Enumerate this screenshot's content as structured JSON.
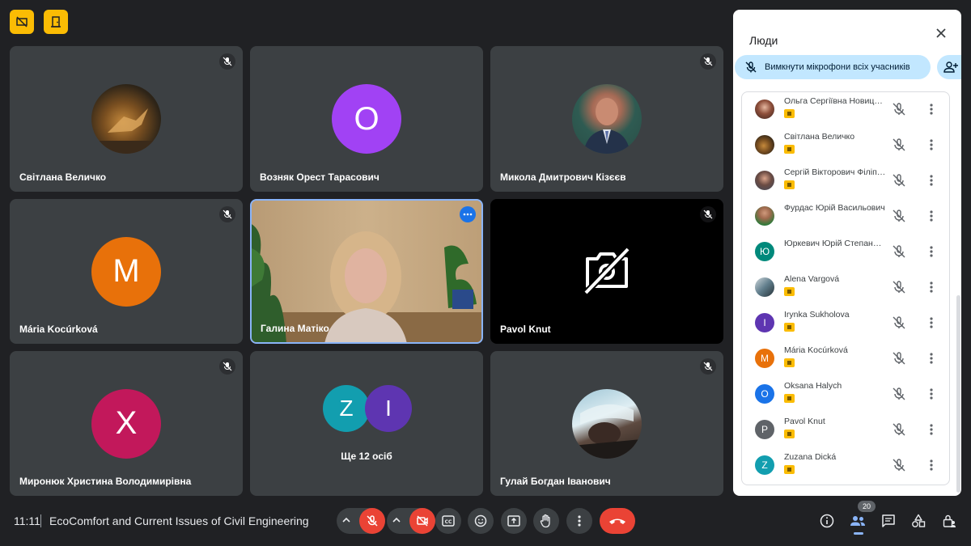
{
  "tiles": [
    {
      "name": "Світлана Величко",
      "avatar_type": "photo-dragon"
    },
    {
      "name": "Возняк Орест Тарасович",
      "initial": "O",
      "color": "#a142f4"
    },
    {
      "name": "Микола Дмитрович Кізєєв",
      "avatar_type": "photo-man"
    },
    {
      "name": "Mária Kocúrková",
      "initial": "M",
      "color": "#e8710a"
    },
    {
      "name": "Галина Матіко",
      "avatar_type": "video"
    },
    {
      "name": "Pavol Knut",
      "avatar_type": "camera-off"
    },
    {
      "name": "Миронюк Христина Володимирівна",
      "initial": "X",
      "color": "#c2185b"
    },
    {
      "name": "",
      "others_label": "Ще 12 осіб",
      "initials": [
        "Z",
        "I"
      ],
      "colors": [
        "#129eaf",
        "#5e35b1"
      ]
    },
    {
      "name": "Гулай Богдан Іванович",
      "avatar_type": "photo-car"
    }
  ],
  "panel": {
    "title": "Люди",
    "mute_all_label": "Вимкнути мікрофони всіх учасників",
    "participants": [
      {
        "name": "Ольга Сергіївна Новицька",
        "initial": "",
        "color": "#8d6e63",
        "photo": true
      },
      {
        "name": "Світлана Величко",
        "initial": "",
        "color": "#6d4c41",
        "photo": true
      },
      {
        "name": "Сергій Вікторович Філіпчук",
        "initial": "",
        "color": "#78909c",
        "photo": true
      },
      {
        "name": "Фурдас Юрій Васильович",
        "initial": "",
        "color": "#a1887f",
        "photo": true
      },
      {
        "name": "Юркевич Юрій Степанович",
        "initial": "Ю",
        "color": "#00897b",
        "photo": false
      },
      {
        "name": "Alena Vargová",
        "initial": "",
        "color": "#90a4ae",
        "photo": true
      },
      {
        "name": "Irynka Sukholova",
        "initial": "I",
        "color": "#5e35b1",
        "photo": false
      },
      {
        "name": "Mária Kocúrková",
        "initial": "M",
        "color": "#e8710a",
        "photo": false
      },
      {
        "name": "Oksana Halych",
        "initial": "O",
        "color": "#1a73e8",
        "photo": false
      },
      {
        "name": "Pavol Knut",
        "initial": "P",
        "color": "#5f6368",
        "photo": false
      },
      {
        "name": "Zuzana Dická",
        "initial": "Z",
        "color": "#129eaf",
        "photo": false
      }
    ]
  },
  "bottom": {
    "time": "11:11",
    "meeting_title": "EcoComfort and Current Issues of Civil Engineering",
    "people_count": "20"
  },
  "colors": {
    "background": "#202124",
    "tile": "#3c4043",
    "accent_blue": "#8ab4f8",
    "red": "#ea4335",
    "badge_yellow": "#fbbc04"
  }
}
